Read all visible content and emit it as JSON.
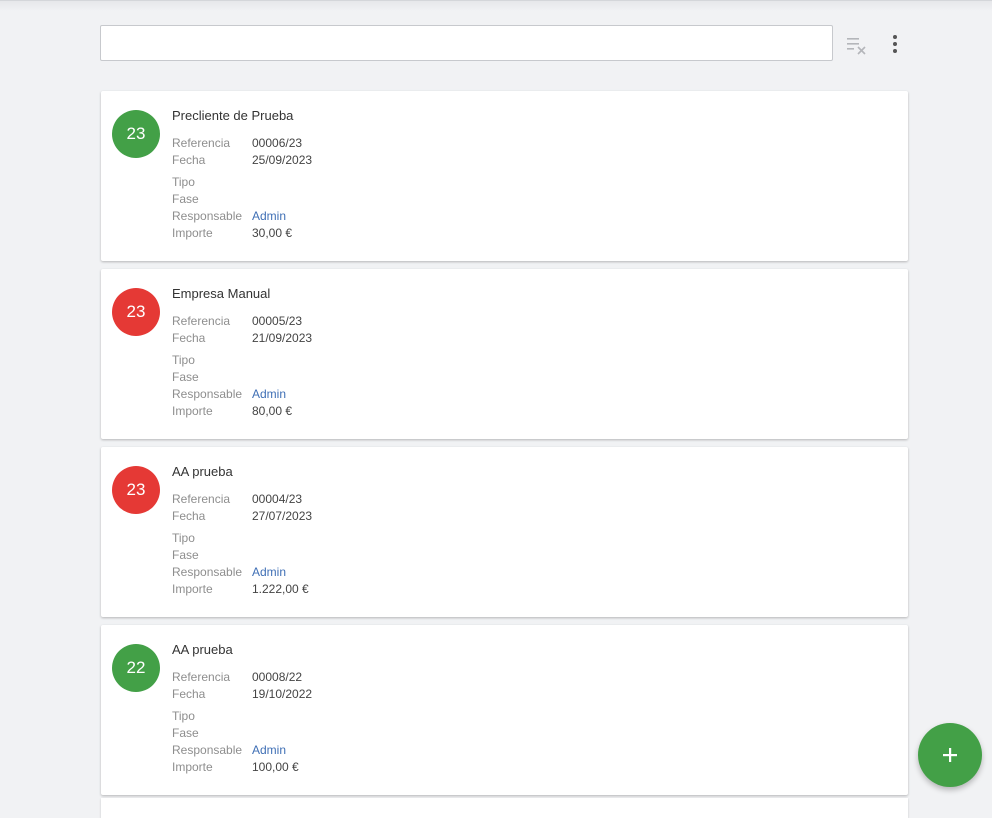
{
  "search": {
    "value": "",
    "placeholder": ""
  },
  "toolbar": {
    "clear_filter_icon": "clear-filter-icon",
    "more_icon": "more-vert-icon"
  },
  "colors": {
    "green": "#43a047",
    "red": "#e53935",
    "link": "#3f6fb5"
  },
  "labels": {
    "referencia": "Referencia",
    "fecha": "Fecha",
    "tipo": "Tipo",
    "fase": "Fase",
    "responsable": "Responsable",
    "importe": "Importe"
  },
  "cards": [
    {
      "badge": "23",
      "badge_color": "green",
      "title": "Precliente de Prueba",
      "referencia": "00006/23",
      "fecha": "25/09/2023",
      "tipo": "",
      "fase": "",
      "responsable": "Admin",
      "importe": "30,00 €"
    },
    {
      "badge": "23",
      "badge_color": "red",
      "title": "Empresa Manual",
      "referencia": "00005/23",
      "fecha": "21/09/2023",
      "tipo": "",
      "fase": "",
      "responsable": "Admin",
      "importe": "80,00 €"
    },
    {
      "badge": "23",
      "badge_color": "red",
      "title": "AA prueba",
      "referencia": "00004/23",
      "fecha": "27/07/2023",
      "tipo": "",
      "fase": "",
      "responsable": "Admin",
      "importe": "1.222,00 €"
    },
    {
      "badge": "22",
      "badge_color": "green",
      "title": "AA prueba",
      "referencia": "00008/22",
      "fecha": "19/10/2022",
      "tipo": "",
      "fase": "",
      "responsable": "Admin",
      "importe": "100,00 €"
    }
  ],
  "fab": {
    "icon": "plus-icon"
  }
}
